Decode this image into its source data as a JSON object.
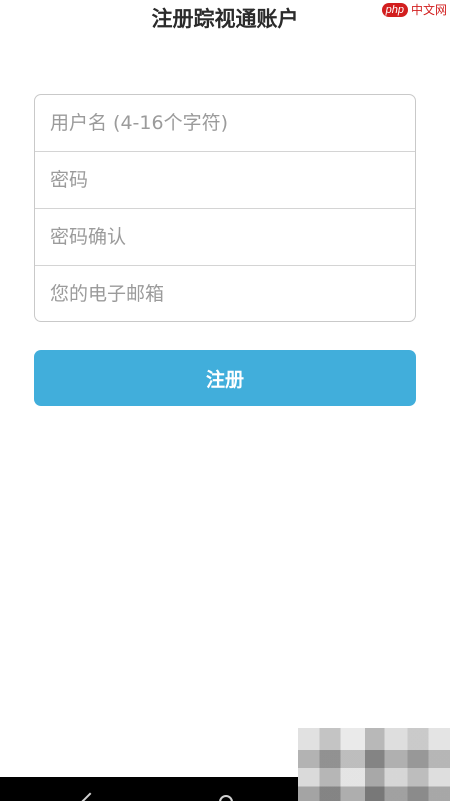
{
  "header": {
    "title": "注册踪视通账户"
  },
  "watermark": {
    "badge": "php",
    "text": "中文网"
  },
  "form": {
    "username_placeholder": "用户名 (4-16个字符)",
    "password_placeholder": "密码",
    "confirm_placeholder": "密码确认",
    "email_placeholder": "您的电子邮箱"
  },
  "actions": {
    "register_label": "注册"
  },
  "colors": {
    "accent": "#41aedb",
    "title": "#2b2b2b",
    "border": "#c9c9c9",
    "placeholder": "#9b9b9b",
    "watermark": "#d21e1e"
  },
  "icons": {
    "nav_back": "back-arrow-icon",
    "nav_home": "home-circle-icon"
  }
}
